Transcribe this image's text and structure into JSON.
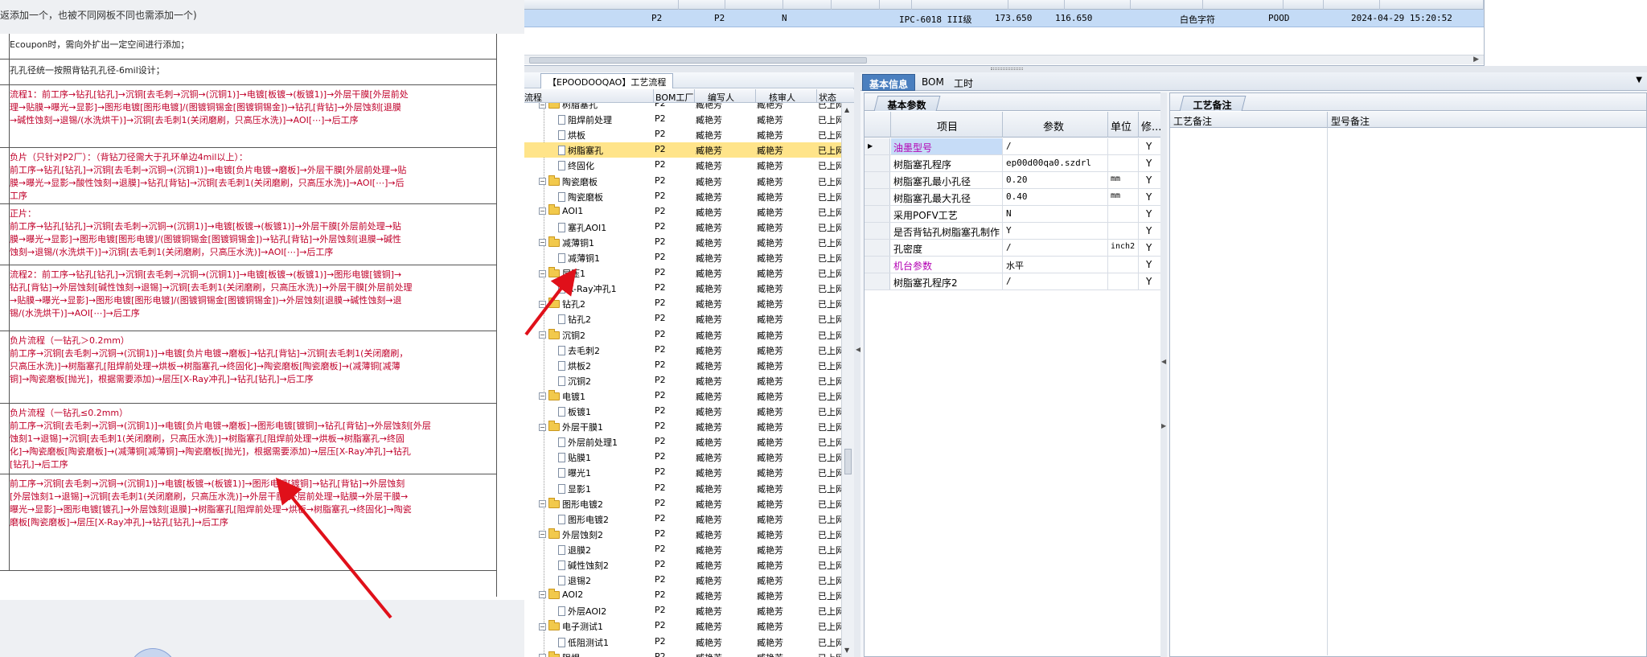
{
  "doc": {
    "top_line": "返添加一个，也被不同网板不同也需添加一个)",
    "plain_rows": [
      "Ecoupon时，需向外扩出一定空间进行添加；",
      "孔孔径统一按照背钻孔孔径-6mil设计；"
    ],
    "flow_rows": [
      "流程1：前工序→钻孔[钻孔]→沉铜[去毛刺→沉铜→(沉铜1)]→电镀[板镀→(板镀1)]→外层干膜[外层前处\n理→贴膜→曝光→显影]→图形电镀[图形电镀]/(图镀铜锡金[图镀铜锡金])→钻孔[背钻]→外层蚀刻[退膜\n→碱性蚀刻→退锡/(水洗烘干)]→沉铜[去毛刺1(关闭磨刷，只高压水洗)]→AOI[⋯]→后工序",
      "负片（只针对P2厂）：（背钻刀径需大于孔环单边4mil以上）：\n前工序→钻孔[钻孔]→沉铜[去毛刺→沉铜→(沉铜1)]→电镀[负片电镀→磨板]→外层干膜[外层前处理→贴\n膜→曝光→显影→酸性蚀刻→退膜]→钻孔[背钻]→沉铜[去毛刺1(关闭磨刷，只高压水洗)]→AOI[⋯]→后\n工序",
      "正片：\n前工序→钻孔[钻孔]→沉铜[去毛刺→沉铜→(沉铜1)]→电镀[板镀→(板镀1)]→外层干膜[外层前处理→贴\n膜→曝光→显影]→图形电镀[图形电镀]/(图镀铜锡金[图镀铜锡金])→钻孔[背钻]→外层蚀刻[退膜→碱性\n蚀刻→退锡/(水洗烘干)]→沉铜[去毛刺1(关闭磨刷，只高压水洗)]→AOI[⋯]→后工序",
      "流程2：前工序→钻孔[钻孔]→沉铜[去毛刺→沉铜→(沉铜1)]→电镀[板镀→(板镀1)]→图形电镀[镀铜]→\n钻孔[背钻]→外层蚀刻[碱性蚀刻→退锡]→沉铜[去毛刺1(关闭磨刷，只高压水洗)]→外层干膜[外层前处理\n→贴膜→曝光→显影]→图形电镀[图形电镀]/(图镀铜锡金[图镀铜锡金])→外层蚀刻[退膜→碱性蚀刻→退\n锡/(水洗烘干)]→AOI[⋯]→后工序",
      "负片流程（一钻孔＞0.2mm）\n前工序→沉铜[去毛刺→沉铜→(沉铜1)]→电镀[负片电镀→磨板]→钻孔[背钻]→沉铜[去毛刺1(关闭磨刷，\n只高压水洗)]→树脂塞孔[阻焊前处理→烘板→树脂塞孔→终固化]→陶瓷磨板[陶瓷磨板]→(减薄铜[减薄\n铜]→陶瓷磨板[抛光]，根据需要添加)→层压[X-Ray冲孔]→钻孔[钻孔]→后工序",
      "负片流程（一钻孔≤0.2mm）\n前工序→沉铜[去毛刺→沉铜→(沉铜1)]→电镀[负片电镀→磨板]→图形电镀[镀铜]→钻孔[背钻]→外层蚀刻[外层\n蚀刻1→退锡]→沉铜[去毛刺1(关闭磨刷，只高压水洗)]→树脂塞孔[阻焊前处理→烘板→树脂塞孔→终固\n化]→陶瓷磨板[陶瓷磨板]→(减薄铜[减薄铜]→陶瓷磨板[抛光]，根据需要添加)→层压[X-Ray冲孔]→钻孔\n[钻孔]→后工序",
      "前工序→沉铜[去毛刺→沉铜→(沉铜1)]→电镀[板镀→(板镀1)]→图形电镀[镀铜]→钻孔[背钻]→外层蚀刻\n[外层蚀刻1→退锡]→沉铜[去毛刺1(关闭磨刷，只高压水洗)]→外层干膜[外层前处理→贴膜→外层干膜→\n曝光→显影]→图形电镀[镀孔]→外层蚀刻[退膜]→树脂塞孔[阻焊前处理→烘板→树脂塞孔→终固化]→陶瓷\n磨板[陶瓷磨板]→层压[X-Ray冲孔]→钻孔[钻孔]→后工序"
    ]
  },
  "top_grid": {
    "row": [
      "P2",
      "P2",
      "N",
      "IPC-6018 III级",
      "173.650",
      "116.650",
      "白色字符",
      "POOD",
      "2024-04-29 15:20:52"
    ]
  },
  "tree": {
    "title": "【EPOODOOQAO】工艺流程",
    "headers": [
      "流程",
      "BOM工厂",
      "编写人",
      "核审人",
      "状态"
    ],
    "rows": [
      {
        "name": "树脂塞孔",
        "level": 1,
        "type": "folder",
        "f": "P2",
        "w": "臧艳芳",
        "r": "臧艳芳",
        "s": "已上网"
      },
      {
        "name": "阻焊前处理",
        "level": 2,
        "type": "doc",
        "f": "P2",
        "w": "臧艳芳",
        "r": "臧艳芳",
        "s": "已上网"
      },
      {
        "name": "烘板",
        "level": 2,
        "type": "doc",
        "f": "P2",
        "w": "臧艳芳",
        "r": "臧艳芳",
        "s": "已上网"
      },
      {
        "name": "树脂塞孔",
        "level": 2,
        "type": "doc",
        "f": "P2",
        "w": "臧艳芳",
        "r": "臧艳芳",
        "s": "已上网",
        "selected": true
      },
      {
        "name": "终固化",
        "level": 2,
        "type": "doc",
        "f": "P2",
        "w": "臧艳芳",
        "r": "臧艳芳",
        "s": "已上网"
      },
      {
        "name": "陶瓷磨板",
        "level": 1,
        "type": "folder",
        "f": "P2",
        "w": "臧艳芳",
        "r": "臧艳芳",
        "s": "已上网"
      },
      {
        "name": "陶瓷磨板",
        "level": 2,
        "type": "doc",
        "f": "P2",
        "w": "臧艳芳",
        "r": "臧艳芳",
        "s": "已上网"
      },
      {
        "name": "AOI1",
        "level": 1,
        "type": "folder",
        "f": "P2",
        "w": "臧艳芳",
        "r": "臧艳芳",
        "s": "已上网"
      },
      {
        "name": "塞孔AOI1",
        "level": 2,
        "type": "doc",
        "f": "P2",
        "w": "臧艳芳",
        "r": "臧艳芳",
        "s": "已上网"
      },
      {
        "name": "减薄铜1",
        "level": 1,
        "type": "folder",
        "f": "P2",
        "w": "臧艳芳",
        "r": "臧艳芳",
        "s": "已上网"
      },
      {
        "name": "减薄铜1",
        "level": 2,
        "type": "doc",
        "f": "P2",
        "w": "臧艳芳",
        "r": "臧艳芳",
        "s": "已上网"
      },
      {
        "name": "层压1",
        "level": 1,
        "type": "folder",
        "f": "P2",
        "w": "臧艳芳",
        "r": "臧艳芳",
        "s": "已上网"
      },
      {
        "name": "X-Ray冲孔1",
        "level": 2,
        "type": "doc",
        "f": "P2",
        "w": "臧艳芳",
        "r": "臧艳芳",
        "s": "已上网"
      },
      {
        "name": "钻孔2",
        "level": 1,
        "type": "folder",
        "f": "P2",
        "w": "臧艳芳",
        "r": "臧艳芳",
        "s": "已上网"
      },
      {
        "name": "钻孔2",
        "level": 2,
        "type": "doc",
        "f": "P2",
        "w": "臧艳芳",
        "r": "臧艳芳",
        "s": "已上网"
      },
      {
        "name": "沉铜2",
        "level": 1,
        "type": "folder",
        "f": "P2",
        "w": "臧艳芳",
        "r": "臧艳芳",
        "s": "已上网"
      },
      {
        "name": "去毛刺2",
        "level": 2,
        "type": "doc",
        "f": "P2",
        "w": "臧艳芳",
        "r": "臧艳芳",
        "s": "已上网"
      },
      {
        "name": "烘板2",
        "level": 2,
        "type": "doc",
        "f": "P2",
        "w": "臧艳芳",
        "r": "臧艳芳",
        "s": "已上网"
      },
      {
        "name": "沉铜2",
        "level": 2,
        "type": "doc",
        "f": "P2",
        "w": "臧艳芳",
        "r": "臧艳芳",
        "s": "已上网"
      },
      {
        "name": "电镀1",
        "level": 1,
        "type": "folder",
        "f": "P2",
        "w": "臧艳芳",
        "r": "臧艳芳",
        "s": "已上网"
      },
      {
        "name": "板镀1",
        "level": 2,
        "type": "doc",
        "f": "P2",
        "w": "臧艳芳",
        "r": "臧艳芳",
        "s": "已上网"
      },
      {
        "name": "外层干膜1",
        "level": 1,
        "type": "folder",
        "f": "P2",
        "w": "臧艳芳",
        "r": "臧艳芳",
        "s": "已上网"
      },
      {
        "name": "外层前处理1",
        "level": 2,
        "type": "doc",
        "f": "P2",
        "w": "臧艳芳",
        "r": "臧艳芳",
        "s": "已上网"
      },
      {
        "name": "贴膜1",
        "level": 2,
        "type": "doc",
        "f": "P2",
        "w": "臧艳芳",
        "r": "臧艳芳",
        "s": "已上网"
      },
      {
        "name": "曝光1",
        "level": 2,
        "type": "doc",
        "f": "P2",
        "w": "臧艳芳",
        "r": "臧艳芳",
        "s": "已上网"
      },
      {
        "name": "显影1",
        "level": 2,
        "type": "doc",
        "f": "P2",
        "w": "臧艳芳",
        "r": "臧艳芳",
        "s": "已上网"
      },
      {
        "name": "图形电镀2",
        "level": 1,
        "type": "folder",
        "f": "P2",
        "w": "臧艳芳",
        "r": "臧艳芳",
        "s": "已上网"
      },
      {
        "name": "图形电镀2",
        "level": 2,
        "type": "doc",
        "f": "P2",
        "w": "臧艳芳",
        "r": "臧艳芳",
        "s": "已上网"
      },
      {
        "name": "外层蚀刻2",
        "level": 1,
        "type": "folder",
        "f": "P2",
        "w": "臧艳芳",
        "r": "臧艳芳",
        "s": "已上网"
      },
      {
        "name": "退膜2",
        "level": 2,
        "type": "doc",
        "f": "P2",
        "w": "臧艳芳",
        "r": "臧艳芳",
        "s": "已上网"
      },
      {
        "name": "碱性蚀刻2",
        "level": 2,
        "type": "doc",
        "f": "P2",
        "w": "臧艳芳",
        "r": "臧艳芳",
        "s": "已上网"
      },
      {
        "name": "退锡2",
        "level": 2,
        "type": "doc",
        "f": "P2",
        "w": "臧艳芳",
        "r": "臧艳芳",
        "s": "已上网"
      },
      {
        "name": "AOI2",
        "level": 1,
        "type": "folder",
        "f": "P2",
        "w": "臧艳芳",
        "r": "臧艳芳",
        "s": "已上网"
      },
      {
        "name": "外层AOI2",
        "level": 2,
        "type": "doc",
        "f": "P2",
        "w": "臧艳芳",
        "r": "臧艳芳",
        "s": "已上网"
      },
      {
        "name": "电子测试1",
        "level": 1,
        "type": "folder",
        "f": "P2",
        "w": "臧艳芳",
        "r": "臧艳芳",
        "s": "已上网"
      },
      {
        "name": "低阻测试1",
        "level": 2,
        "type": "doc",
        "f": "P2",
        "w": "臧艳芳",
        "r": "臧艳芳",
        "s": "已上网"
      },
      {
        "name": "阻焊",
        "level": 1,
        "type": "folder",
        "f": "P2",
        "w": "臧艳芳",
        "r": "臧艳芳",
        "s": "已上网"
      }
    ]
  },
  "main_tabs": [
    "基本信息",
    "BOM",
    "工时"
  ],
  "params_panel": {
    "title": "基本参数",
    "headers": [
      "项目",
      "参数",
      "单位",
      "修..."
    ],
    "rows": [
      {
        "item": "油墨型号",
        "value": "/",
        "unit": "",
        "mod": "Y",
        "purple": true,
        "current": true
      },
      {
        "item": "树脂塞孔程序",
        "value": "ep00d00qa0.szdrl",
        "unit": "",
        "mod": "Y"
      },
      {
        "item": "树脂塞孔最小孔径",
        "value": "0.20",
        "unit": "mm",
        "mod": "Y"
      },
      {
        "item": "树脂塞孔最大孔径",
        "value": "0.40",
        "unit": "mm",
        "mod": "Y"
      },
      {
        "item": "采用POFV工艺",
        "value": "N",
        "unit": "",
        "mod": "Y"
      },
      {
        "item": "是否背钻孔树脂塞孔制作",
        "value": "Y",
        "unit": "",
        "mod": "Y"
      },
      {
        "item": "孔密度",
        "value": "/",
        "unit": "inch2",
        "mod": "Y"
      },
      {
        "item": "机台参数",
        "value": "水平",
        "unit": "",
        "mod": "Y",
        "purple": true
      },
      {
        "item": "树脂塞孔程序2",
        "value": "/",
        "unit": "",
        "mod": "Y"
      }
    ]
  },
  "notes_panel": {
    "title": "工艺备注",
    "headers": [
      "工艺备注",
      "型号备注"
    ]
  }
}
